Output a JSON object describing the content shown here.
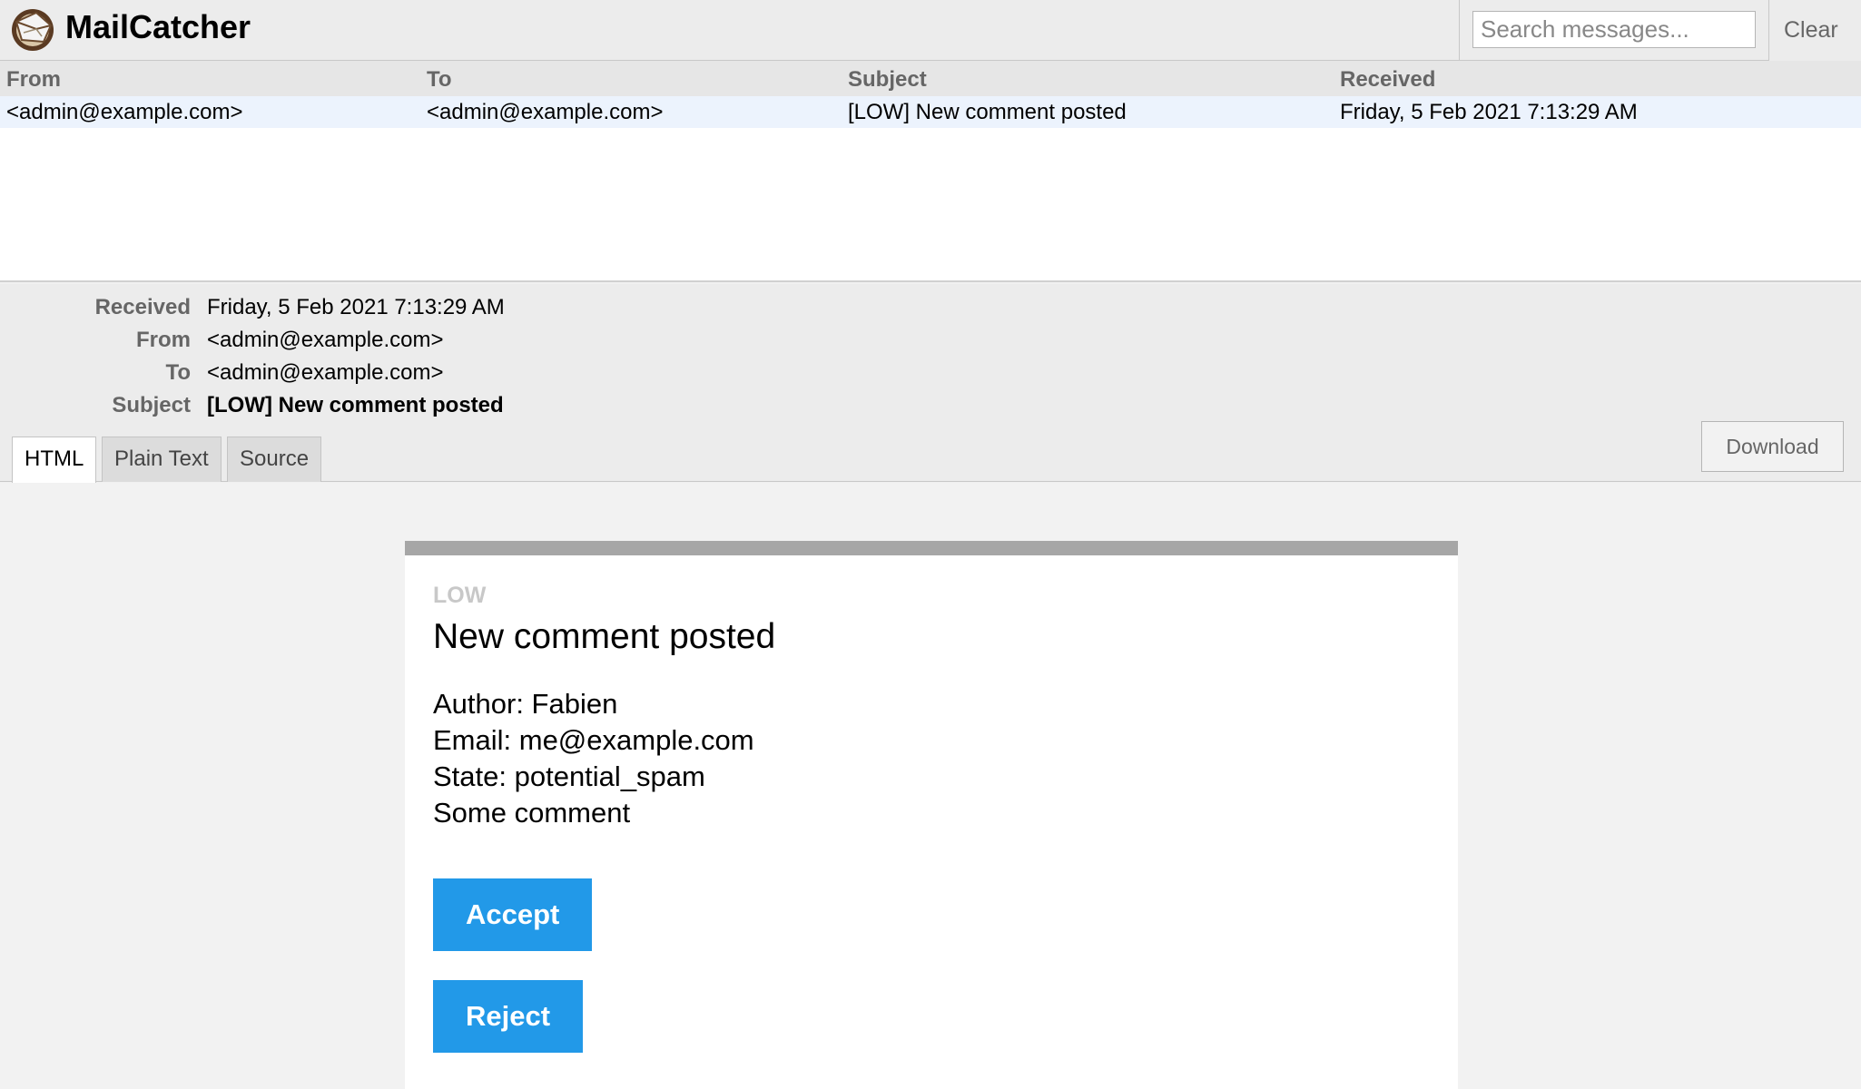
{
  "app": {
    "title": "MailCatcher",
    "logo_icon": "mailcatcher-logo-icon"
  },
  "search": {
    "placeholder": "Search messages...",
    "value": ""
  },
  "header": {
    "clear_label": "Clear"
  },
  "message_list": {
    "columns": [
      "From",
      "To",
      "Subject",
      "Received"
    ],
    "rows": [
      {
        "from": "<admin@example.com>",
        "to": "<admin@example.com>",
        "subject": "[LOW] New comment posted",
        "received": "Friday, 5 Feb 2021 7:13:29 AM"
      }
    ]
  },
  "message": {
    "labels": {
      "received": "Received",
      "from": "From",
      "to": "To",
      "subject": "Subject"
    },
    "received": "Friday, 5 Feb 2021 7:13:29 AM",
    "from": "<admin@example.com>",
    "to": "<admin@example.com>",
    "subject": "[LOW] New comment posted",
    "tabs": [
      {
        "label": "HTML",
        "active": true
      },
      {
        "label": "Plain Text",
        "active": false
      },
      {
        "label": "Source",
        "active": false
      }
    ],
    "download_label": "Download"
  },
  "email": {
    "priority": "LOW",
    "title": "New comment posted",
    "lines": [
      "Author: Fabien",
      "Email: me@example.com",
      "State: potential_spam",
      "Some comment"
    ],
    "accept_label": "Accept",
    "reject_label": "Reject",
    "button_color": "#2299e8",
    "header_bar_color": "#a6a6a6"
  }
}
